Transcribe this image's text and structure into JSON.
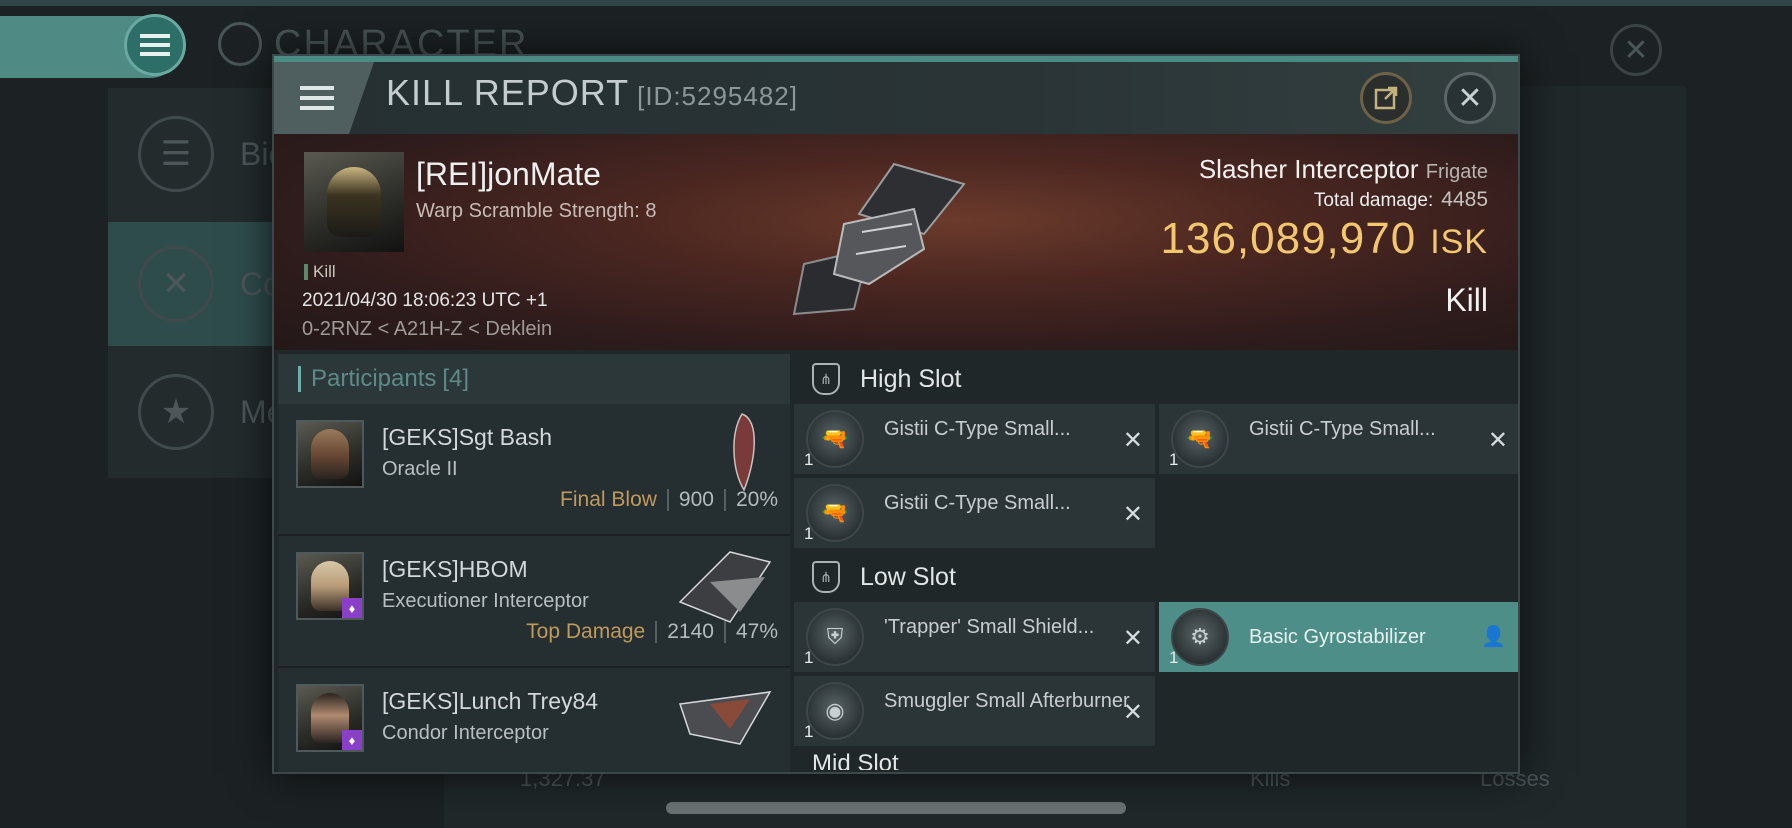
{
  "background": {
    "title": "CHARACTER",
    "side_items": [
      {
        "label": "Bio",
        "icon": "list-icon"
      },
      {
        "label": "Co",
        "icon": "crossed-swords-icon"
      },
      {
        "label": "Me",
        "icon": "star-medal-icon"
      }
    ],
    "stats_value": "1,327.37",
    "kills_label": "Kills",
    "losses_label": "Losses"
  },
  "modal": {
    "title": "KILL REPORT",
    "id": "[ID:5295482]"
  },
  "victim": {
    "name": "[REI]jonMate",
    "subtitle": "Warp Scramble Strength: 8",
    "kill_tag": "Kill",
    "datetime": "2021/04/30 18:06:23 UTC +1",
    "location": "0-2RNZ < A21H-Z < Deklein",
    "ship": "Slasher Interceptor",
    "ship_class": "Frigate",
    "damage_label": "Total damage:",
    "damage_value": "4485",
    "isk_value": "136,089,970",
    "isk_unit": "ISK",
    "result": "Kill"
  },
  "participants": {
    "label": "Participants",
    "count": "[4]",
    "rows": [
      {
        "name": "[GEKS]Sgt Bash",
        "ship": "Oracle II",
        "tag": "Final Blow",
        "damage": "900",
        "percent": "20%",
        "badge": false
      },
      {
        "name": "[GEKS]HBOM",
        "ship": "Executioner Interceptor",
        "tag": "Top Damage",
        "damage": "2140",
        "percent": "47%",
        "badge": true
      },
      {
        "name": "[GEKS]Lunch Trey84",
        "ship": "Condor Interceptor",
        "tag": "",
        "damage": "",
        "percent": "",
        "badge": true
      }
    ]
  },
  "slots": {
    "high": {
      "label": "High Slot",
      "items": [
        {
          "name": "Gistii C-Type Small...",
          "qty": "1",
          "state": "destroyed"
        },
        {
          "name": "Gistii C-Type Small...",
          "qty": "1",
          "state": "destroyed"
        },
        {
          "name": "Gistii C-Type Small...",
          "qty": "1",
          "state": "destroyed"
        }
      ]
    },
    "low": {
      "label": "Low Slot",
      "items": [
        {
          "name": "'Trapper' Small Shield...",
          "qty": "1",
          "state": "destroyed"
        },
        {
          "name": "Basic Gyrostabilizer",
          "qty": "1",
          "state": "dropped"
        },
        {
          "name": "Smuggler Small Afterburner",
          "qty": "1",
          "state": "destroyed"
        }
      ]
    },
    "mid_partial_label": "Mid Slot"
  },
  "colors": {
    "accent": "#4d8f88",
    "isk": "#f2c76e",
    "tag": "#c09a5a"
  }
}
